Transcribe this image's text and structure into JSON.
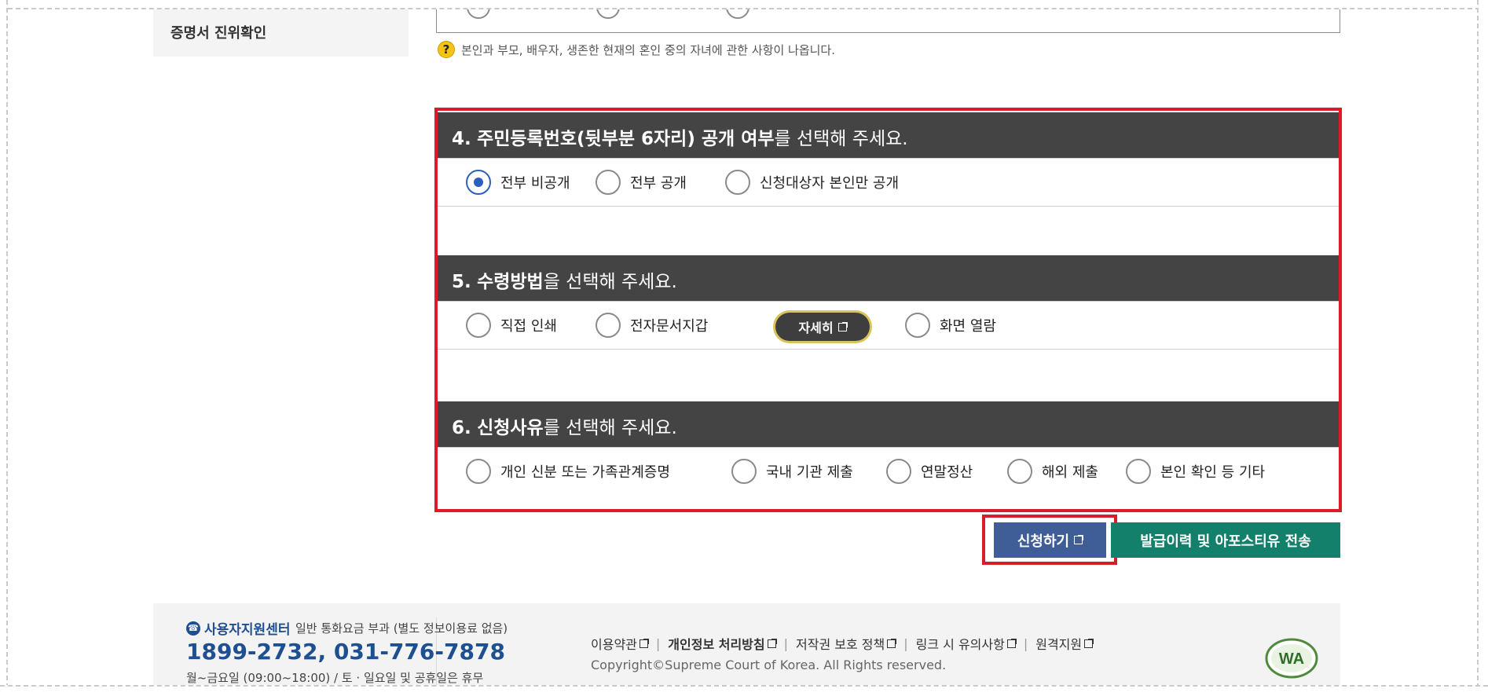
{
  "sidebar": {
    "items": [
      {
        "label": "증명서 진위확인"
      }
    ]
  },
  "hint": {
    "icon": "question-icon",
    "text": "본인과 부모, 배우자, 생존한 현재의 혼인 중의 자녀에 관한 사항이 나옵니다."
  },
  "q4": {
    "number": "4.",
    "bold": "주민등록번호(뒷부분 6자리) 공개 여부",
    "rest": "를 선택해 주세요.",
    "options": [
      {
        "label": "전부 비공개",
        "checked": true
      },
      {
        "label": "전부 공개",
        "checked": false
      },
      {
        "label": "신청대상자 본인만 공개",
        "checked": false
      }
    ]
  },
  "q5": {
    "number": "5.",
    "bold": "수령방법",
    "rest": "을 선택해 주세요.",
    "options": [
      {
        "label": "직접 인쇄",
        "checked": false
      },
      {
        "label": "전자문서지갑",
        "checked": false
      },
      {
        "label": "화면 열람",
        "checked": false
      }
    ],
    "detail_button": "자세히"
  },
  "q6": {
    "number": "6.",
    "bold": "신청사유",
    "rest": "를 선택해 주세요.",
    "options": [
      {
        "label": "개인 신분 또는 가족관계증명",
        "checked": false
      },
      {
        "label": "국내 기관 제출",
        "checked": false
      },
      {
        "label": "연말정산",
        "checked": false
      },
      {
        "label": "해외 제출",
        "checked": false
      },
      {
        "label": "본인 확인 등 기타",
        "checked": false
      }
    ]
  },
  "actions": {
    "apply": "신청하기",
    "history": "발급이력 및 아포스티유 전송"
  },
  "footer": {
    "support_title": "사용자지원센터",
    "support_note": "일반 통화요금 부과 (별도 정보이용료 없음)",
    "phone": "1899-2732, 031-776-7878",
    "hours": "월~금요일 (09:00~18:00) / 토 · 일요일 및 공휴일은 휴무",
    "links": [
      "이용약관",
      "개인정보 처리방침",
      "저작권 보호 정책",
      "링크 시 유의사항",
      "원격지원"
    ],
    "copyright": "Copyright©Supreme Court of Korea. All Rights reserved.",
    "badge_text": "WA"
  },
  "colors": {
    "header_bg": "#444444",
    "highlight_red": "#d91c2a",
    "apply_blue": "#3f5e98",
    "history_green": "#12806b",
    "radio_checked": "#2c5fbd",
    "footer_blue": "#1d4f91"
  }
}
